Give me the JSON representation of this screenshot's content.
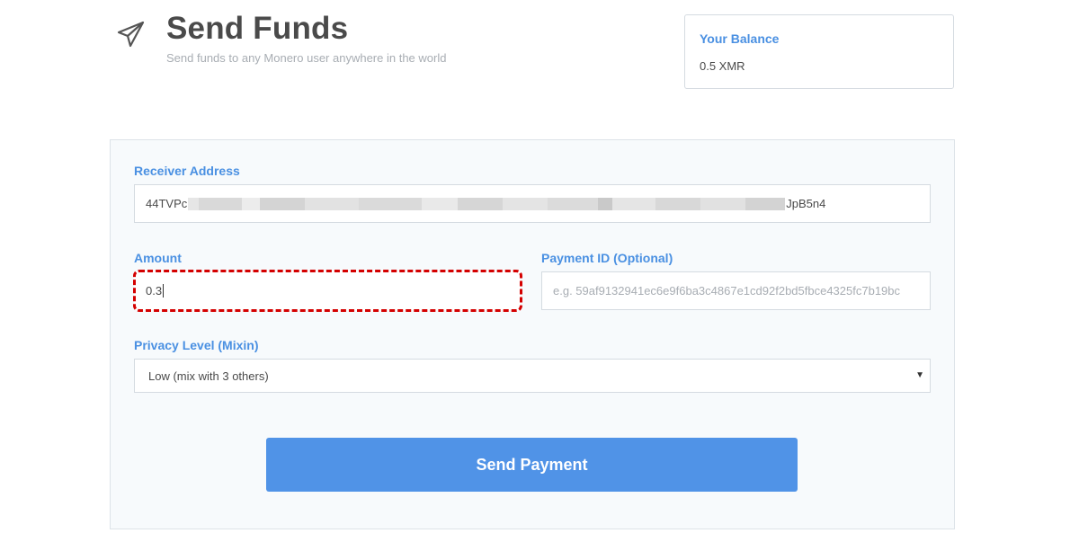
{
  "header": {
    "title": "Send Funds",
    "subtitle": "Send funds to any Monero user anywhere in the world",
    "icon": "paper-plane-icon"
  },
  "balance": {
    "label": "Your Balance",
    "value": "0.5 XMR"
  },
  "form": {
    "receiver": {
      "label": "Receiver Address",
      "value_start": "44TVPc",
      "value_end": "JpB5n4"
    },
    "amount": {
      "label": "Amount",
      "value": "0.3"
    },
    "payment_id": {
      "label": "Payment ID (Optional)",
      "placeholder": "e.g. 59af9132941ec6e9f6ba3c4867e1cd92f2bd5fbce4325fc7b19bc"
    },
    "privacy": {
      "label": "Privacy Level (Mixin)",
      "selected": "Low (mix with 3 others)"
    },
    "send_label": "Send Payment"
  },
  "colors": {
    "accent": "#4a90e2",
    "button": "#5093e7",
    "highlight": "#d40000"
  }
}
